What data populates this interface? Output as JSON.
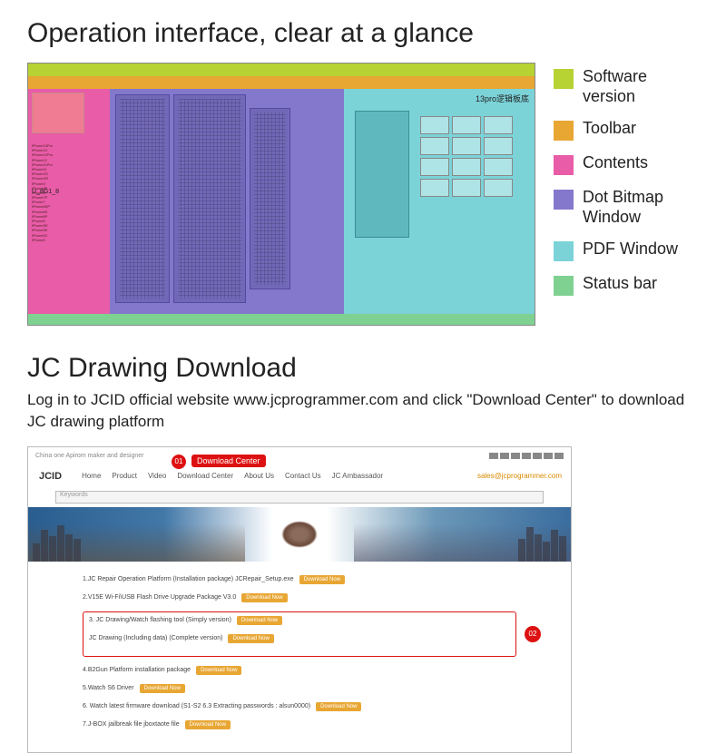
{
  "section1": {
    "title": "Operation interface, clear at a glance",
    "app": {
      "tree_label": "U_8G1_8",
      "pdf_label": "13pro逻辑板底"
    },
    "legend": [
      {
        "color": "#b6d233",
        "label": "Software version"
      },
      {
        "color": "#e8a633",
        "label": "Toolbar"
      },
      {
        "color": "#e85ca8",
        "label": "Contents"
      },
      {
        "color": "#8378cc",
        "label": "Dot Bitmap Window"
      },
      {
        "color": "#7bd3d8",
        "label": "PDF Window"
      },
      {
        "color": "#7fd191",
        "label": "Status bar"
      }
    ]
  },
  "section2": {
    "title": "JC Drawing Download",
    "subtitle": "Log in to JCID official website www.jcprogrammer.com and click \"Download Center\" to download JC drawing platform",
    "website": {
      "tagline": "China one Apirom maker and designer",
      "brand": "JCID",
      "nav": [
        "Home",
        "Product",
        "Video",
        "Download Center",
        "About Us",
        "Contact Us",
        "JC Ambassador"
      ],
      "email": "sales@jcprogrammer.com",
      "search_placeholder": "Keywords",
      "callout1_label": "Download Center",
      "callout2_label": "02",
      "downloads": [
        "1.JC Repair Operation Platform (Installation package)  JCRepair_Setup.exe",
        "2.V15E Wi-Fi\\USB Flash Drive Upgrade Package V3.0",
        "3. JC Drawing/Watch flashing tool (Simply version)",
        "JC Drawing (Including data) (Complete version)",
        "4.B2Gun Platform installation package",
        "5.Watch S6 Driver",
        "6. Watch latest firmware download  (S1-S2 6.3 Extracting passwords : alsun0000)",
        "7.J-BOX jailbreak file  jboxtaote file"
      ],
      "download_btn": "Download Now"
    }
  }
}
